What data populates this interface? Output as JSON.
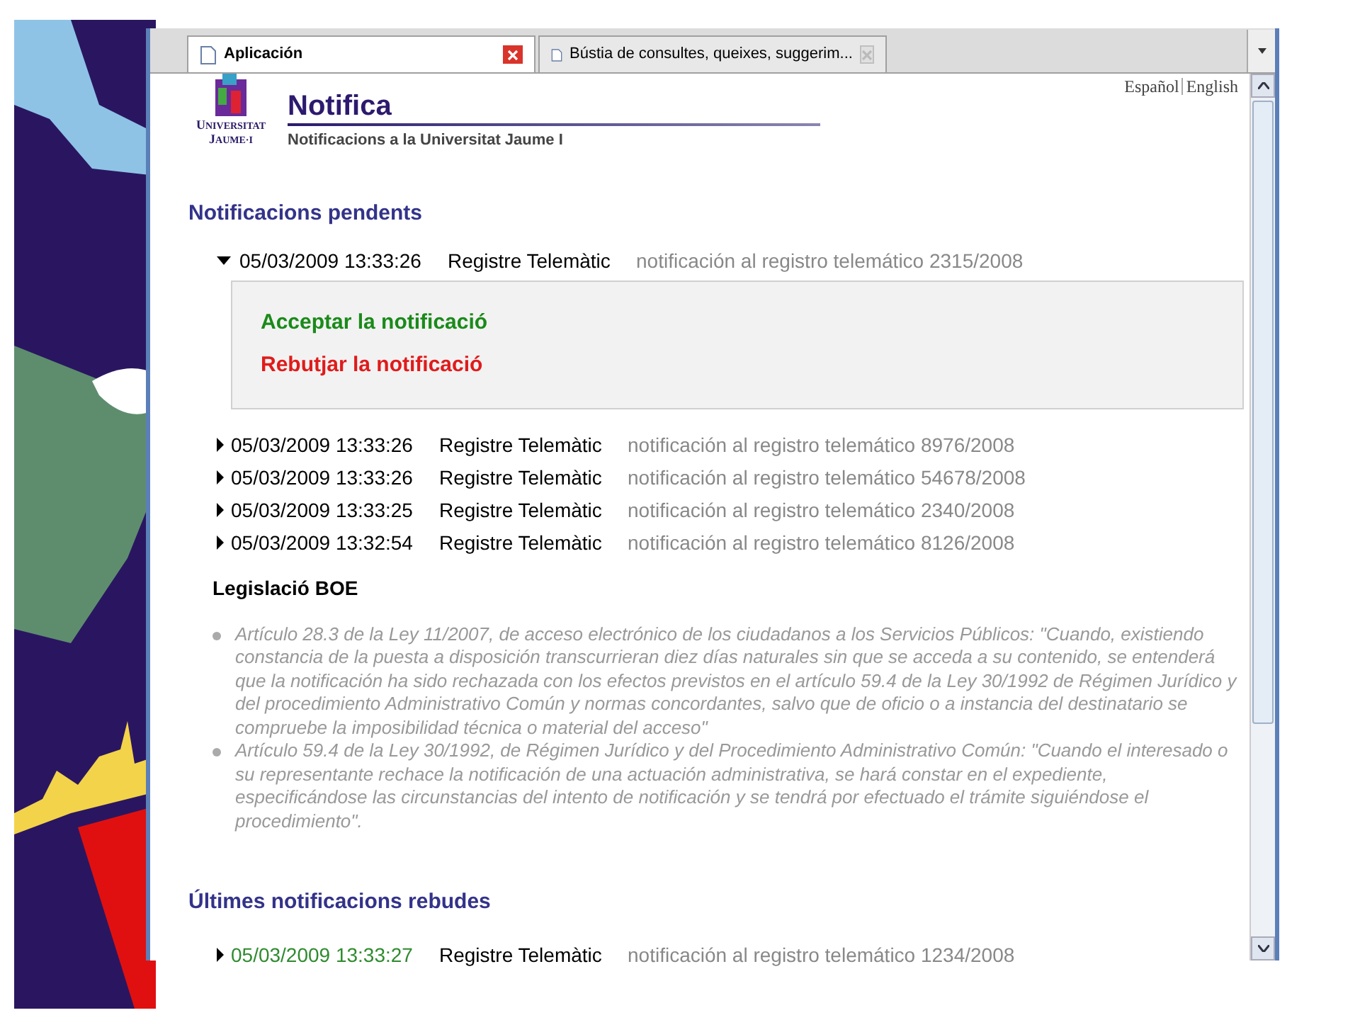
{
  "tabs": [
    {
      "label": "Aplicación",
      "selected": true
    },
    {
      "label": "Bústia de consultes, queixes, suggerim...",
      "selected": false
    }
  ],
  "header": {
    "logo_first": [
      "U",
      "J"
    ],
    "logo_rest": [
      "NIVERSITAT",
      "AUME·I"
    ],
    "title": "Notifica",
    "subtitle": "Notificacions a la Universitat Jaume I"
  },
  "languages": [
    "Español",
    "English"
  ],
  "pending": {
    "heading": "Notificacions pendents",
    "items": [
      {
        "date": "05/03/2009 13:33:26",
        "source": "Registre Telemàtic",
        "description": "notificación al registro telemático 2315/2008",
        "expanded": true,
        "actions": [
          {
            "label": "Acceptar la notificació",
            "kind": "accept"
          },
          {
            "label": "Rebutjar la notificació",
            "kind": "reject"
          }
        ]
      },
      {
        "date": "05/03/2009 13:33:26",
        "source": "Registre Telemàtic",
        "description": "notificación al registro telemático 8976/2008",
        "expanded": false
      },
      {
        "date": "05/03/2009 13:33:26",
        "source": "Registre Telemàtic",
        "description": "notificación al registro telemático 54678/2008",
        "expanded": false
      },
      {
        "date": "05/03/2009 13:33:25",
        "source": "Registre Telemàtic",
        "description": "notificación al registro telemático 2340/2008",
        "expanded": false
      },
      {
        "date": "05/03/2009 13:32:54",
        "source": "Registre Telemàtic",
        "description": "notificación al registro telemático 8126/2008",
        "expanded": false
      }
    ]
  },
  "legislation": {
    "heading": "Legislació BOE",
    "items": [
      "Artículo 28.3 de la Ley 11/2007, de acceso electrónico de los ciudadanos a los Servicios Públicos: \"Cuando, existiendo constancia de la puesta a disposición transcurrieran diez días naturales sin que se acceda a su contenido, se entenderá que la notificación ha sido rechazada con los efectos previstos en el artículo 59.4 de la Ley 30/1992 de Régimen Jurídico y del procedimiento Administrativo Común y normas concordantes, salvo que de oficio o a instancia del destinatario se compruebe la imposibilidad técnica o material del acceso\"",
      "Artículo 59.4 de la Ley 30/1992, de Régimen Jurídico y del Procedimiento Administrativo Común: \"Cuando el interesado o su representante rechace la notificación de una actuación administrativa, se hará constar en el expediente, especificándose las circunstancias del intento de notificación y se tendrá por efectuado el trámite siguiéndose el procedimiento\"."
    ]
  },
  "received": {
    "heading": "Últimes notificacions rebudes",
    "items": [
      {
        "date": "05/03/2009 13:33:27",
        "source": "Registre Telemàtic",
        "description": "notificación al registro telemático 1234/2008",
        "expanded": false
      }
    ]
  }
}
